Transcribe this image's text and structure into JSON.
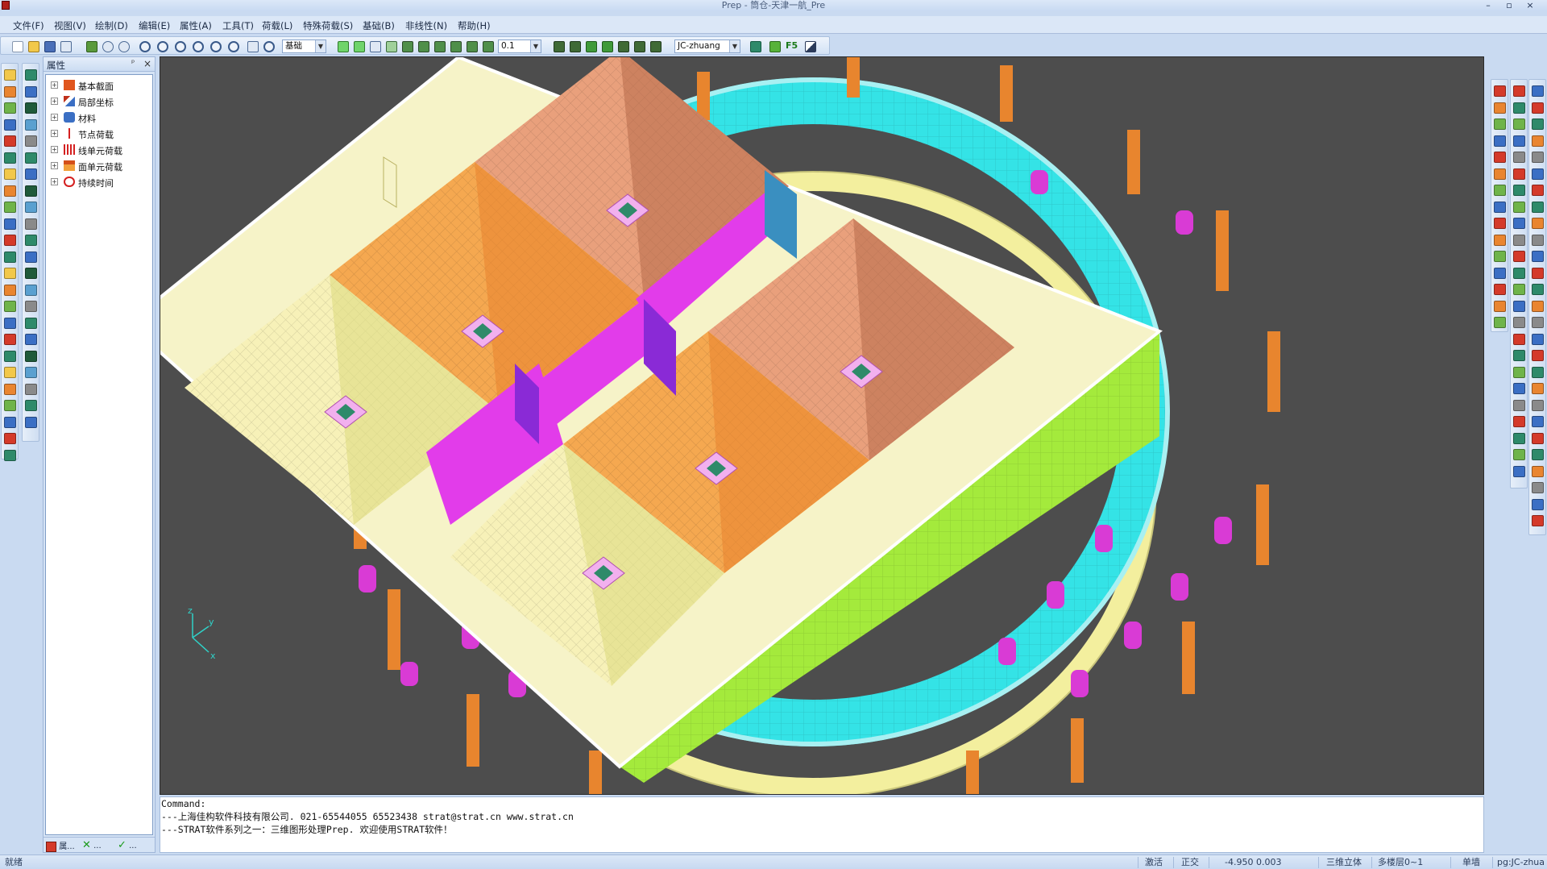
{
  "window": {
    "title": "Prep - 筒仓-天津一航_Pre",
    "minimize": "–",
    "restore": "▫",
    "close": "×"
  },
  "menu": [
    {
      "label": "文件(F)"
    },
    {
      "label": "视图(V)"
    },
    {
      "label": "绘制(D)"
    },
    {
      "label": "编辑(E)"
    },
    {
      "label": "属性(A)"
    },
    {
      "label": "工具(T)"
    },
    {
      "label": "荷载(L)"
    },
    {
      "label": "特殊荷载(S)"
    },
    {
      "label": "基础(B)"
    },
    {
      "label": "非线性(N)"
    },
    {
      "label": "帮助(H)"
    }
  ],
  "toolbar": {
    "layer_combo": "基础",
    "scale_combo": "0.1",
    "user_combo": "JC-zhuang",
    "f5_label": "F5"
  },
  "property_panel": {
    "title": "属性",
    "pin": "ᵖ",
    "close": "×",
    "tree": [
      {
        "label": "基本截面",
        "icon": "section-icon",
        "color": "#e0561e"
      },
      {
        "label": "局部坐标",
        "icon": "local-axes-icon",
        "color": "#c0301a"
      },
      {
        "label": "材料",
        "icon": "material-icon",
        "color": "#3b6fc4"
      },
      {
        "label": "节点荷载",
        "icon": "node-load-icon",
        "color": "#d42020"
      },
      {
        "label": "线单元荷载",
        "icon": "line-load-icon",
        "color": "#d42020"
      },
      {
        "label": "面单元荷载",
        "icon": "area-load-icon",
        "color": "#d4501a"
      },
      {
        "label": "持续时间",
        "icon": "duration-clock-icon",
        "color": "#d42020"
      }
    ],
    "tabs": [
      {
        "label": "属..."
      },
      {
        "label": "..."
      },
      {
        "label": "..."
      }
    ]
  },
  "axis_labels": {
    "z": "z",
    "y": "y",
    "x": "x"
  },
  "command": {
    "lines": [
      "Command:",
      "---上海佳构软件科技有限公司.   021-65544055 65523438  strat@strat.cn  www.strat.cn",
      "---STRAT软件系列之一：三维图形处理Prep. 欢迎使用STRAT软件！"
    ]
  },
  "status": {
    "ready": "就绪",
    "activate": "激活",
    "ortho": "正交",
    "coords": "-4.950  0.003",
    "view3d": "三维立体",
    "floors": "多楼层0~1",
    "wall": "单墙",
    "user": "pg:JC-zhua"
  },
  "colors": {
    "viewport_bg": "#4d4d4d",
    "ring_wall": "#34e3e6",
    "ring_beam": "#f3ef9e",
    "column": "#e8852e",
    "pile": "#d93bd5",
    "hopper_light": "#f7f1b8",
    "hopper_orange": "#f5a850",
    "hopper_salmon": "#e9a07c",
    "magenta_wall": "#e23cea",
    "blue_wall": "#3a8fc0",
    "green_wall": "#a4ea3c"
  }
}
